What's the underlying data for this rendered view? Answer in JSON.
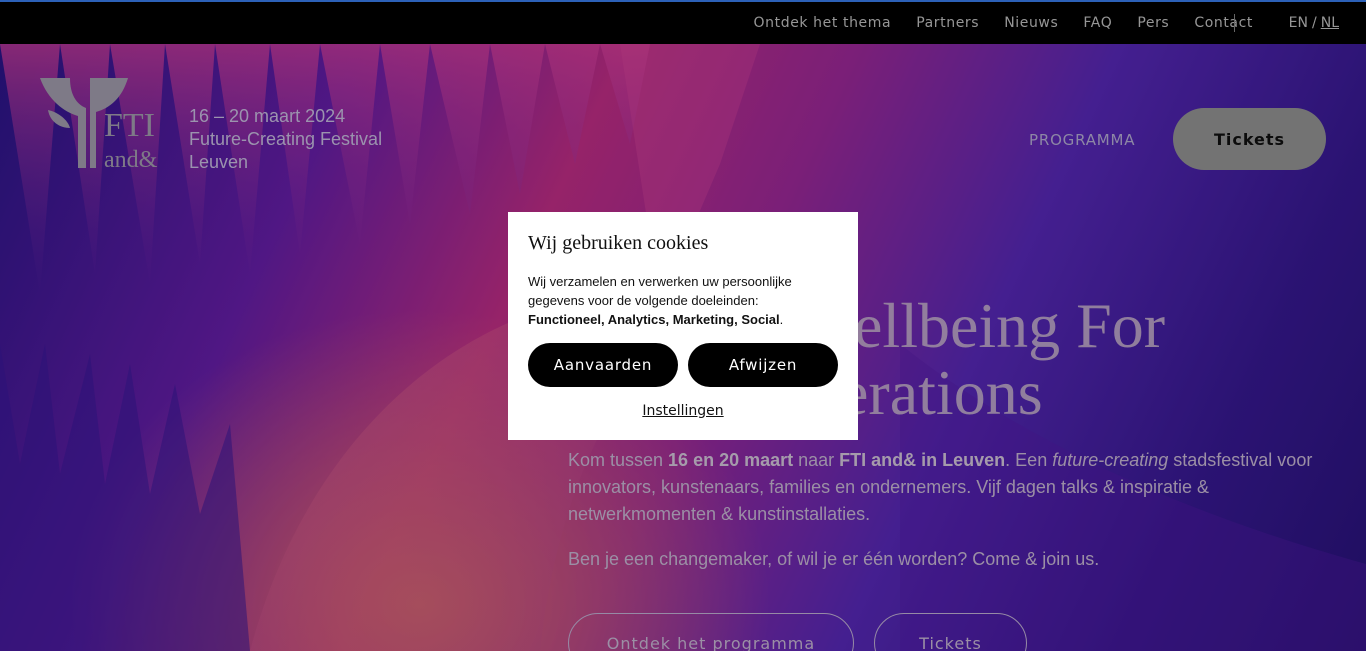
{
  "topnav": {
    "items": [
      "Ontdek het thema",
      "Partners",
      "Nieuws",
      "FAQ",
      "Pers",
      "Contact"
    ],
    "lang_en": "EN",
    "lang_sep": "/",
    "lang_nl": "NL"
  },
  "header": {
    "logo_fti": "FTI",
    "logo_and": "and&",
    "dates": "16 – 20 maart 2024",
    "festival": "Future-Creating Festival",
    "city": "Leuven",
    "nav_programma": "PROGRAMMA",
    "tickets": "Tickets"
  },
  "hero": {
    "headline_line1": "ellbeing For",
    "headline_line2": "erations",
    "intro_1": "Kom tussen ",
    "intro_dates": "16 en 20 maart",
    "intro_2": " naar ",
    "intro_fti": "FTI and& in Leuven",
    "intro_3": ". Een ",
    "intro_em": "future-creating",
    "intro_4": " stadsfestival voor innovators, kunstenaars, families en ondernemers. Vijf dagen talks & inspiratie & netwerkmomenten & kunstinstallaties.",
    "intro2": "Ben je een changemaker, of wil je er één worden? Come & join us.",
    "cta_programma": "Ontdek het programma",
    "cta_tickets": "Tickets"
  },
  "cookie": {
    "title": "Wij gebruiken cookies",
    "text": "Wij verzamelen en verwerken uw persoonlijke gegevens voor de volgende doeleinden: ",
    "purposes": "Functioneel, Analytics, Marketing, Social",
    "period": ".",
    "accept": "Aanvaarden",
    "reject": "Afwijzen",
    "settings": "Instellingen"
  },
  "colors": {
    "accent": "#3b82f6",
    "tickets_bg": "#9a9a9a"
  }
}
